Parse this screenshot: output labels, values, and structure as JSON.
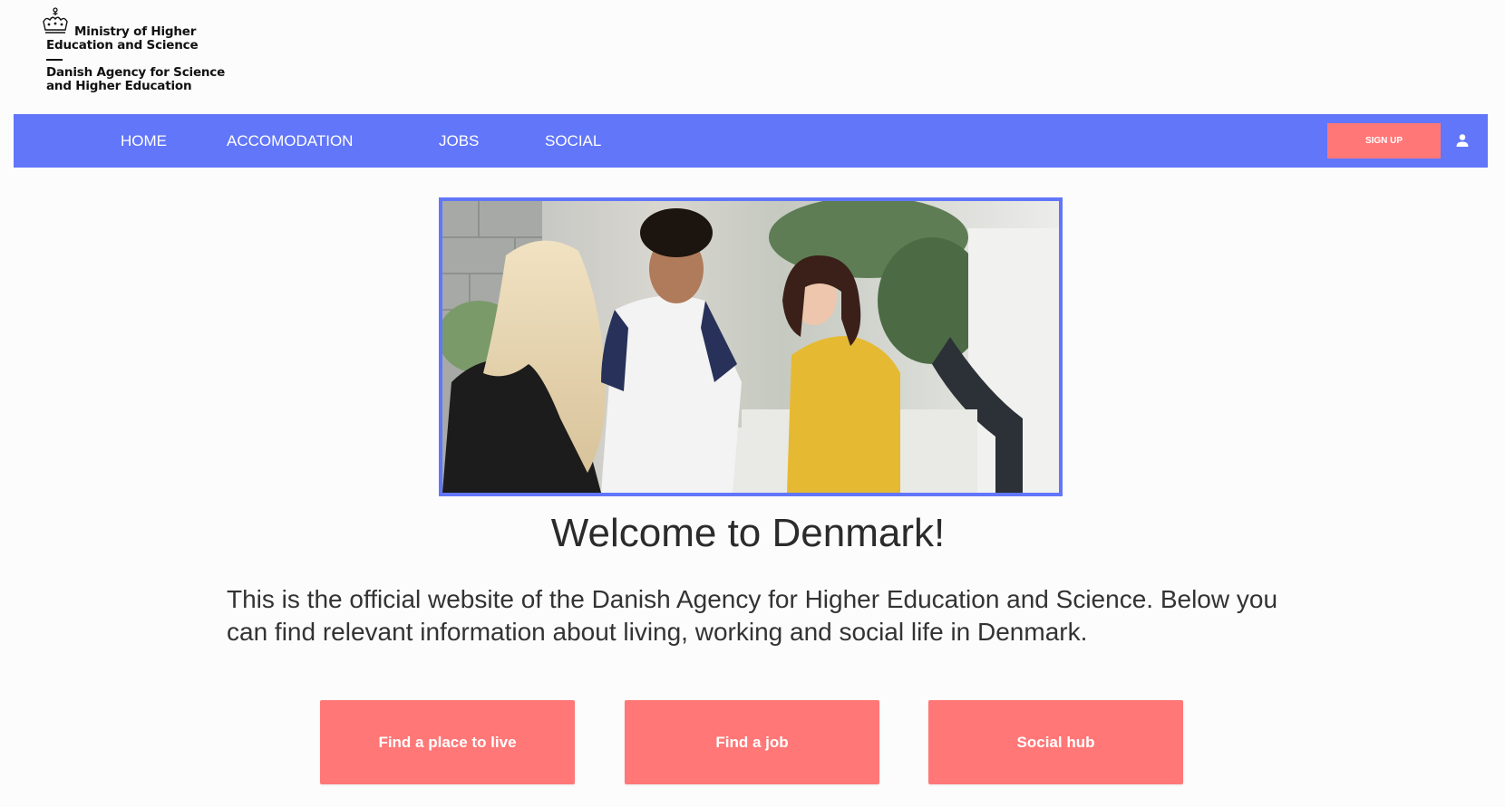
{
  "logo": {
    "line1": "Ministry of Higher",
    "line2": "Education and Science",
    "line3": "Danish Agency for Science",
    "line4": "and Higher Education",
    "icon": "crown-icon"
  },
  "nav": {
    "items": [
      {
        "label": "HOME"
      },
      {
        "label": "ACCOMODATION"
      },
      {
        "label": "JOBS"
      },
      {
        "label": "SOCIAL"
      }
    ],
    "signup_label": "SIGN UP",
    "user_icon": "user-icon"
  },
  "hero": {
    "image": "photo-of-students-talking"
  },
  "main": {
    "title": "Welcome to Denmark!",
    "intro": "This is the official website of the Danish Agency for Higher Education and Science. Below you can find relevant information about living, working and social life in Denmark.",
    "buttons": [
      {
        "label": "Find a place to live"
      },
      {
        "label": "Find a job"
      },
      {
        "label": "Social hub"
      }
    ]
  },
  "colors": {
    "nav_bg": "#6276fa",
    "accent": "#ff7777",
    "background": "#fcfcfd"
  }
}
